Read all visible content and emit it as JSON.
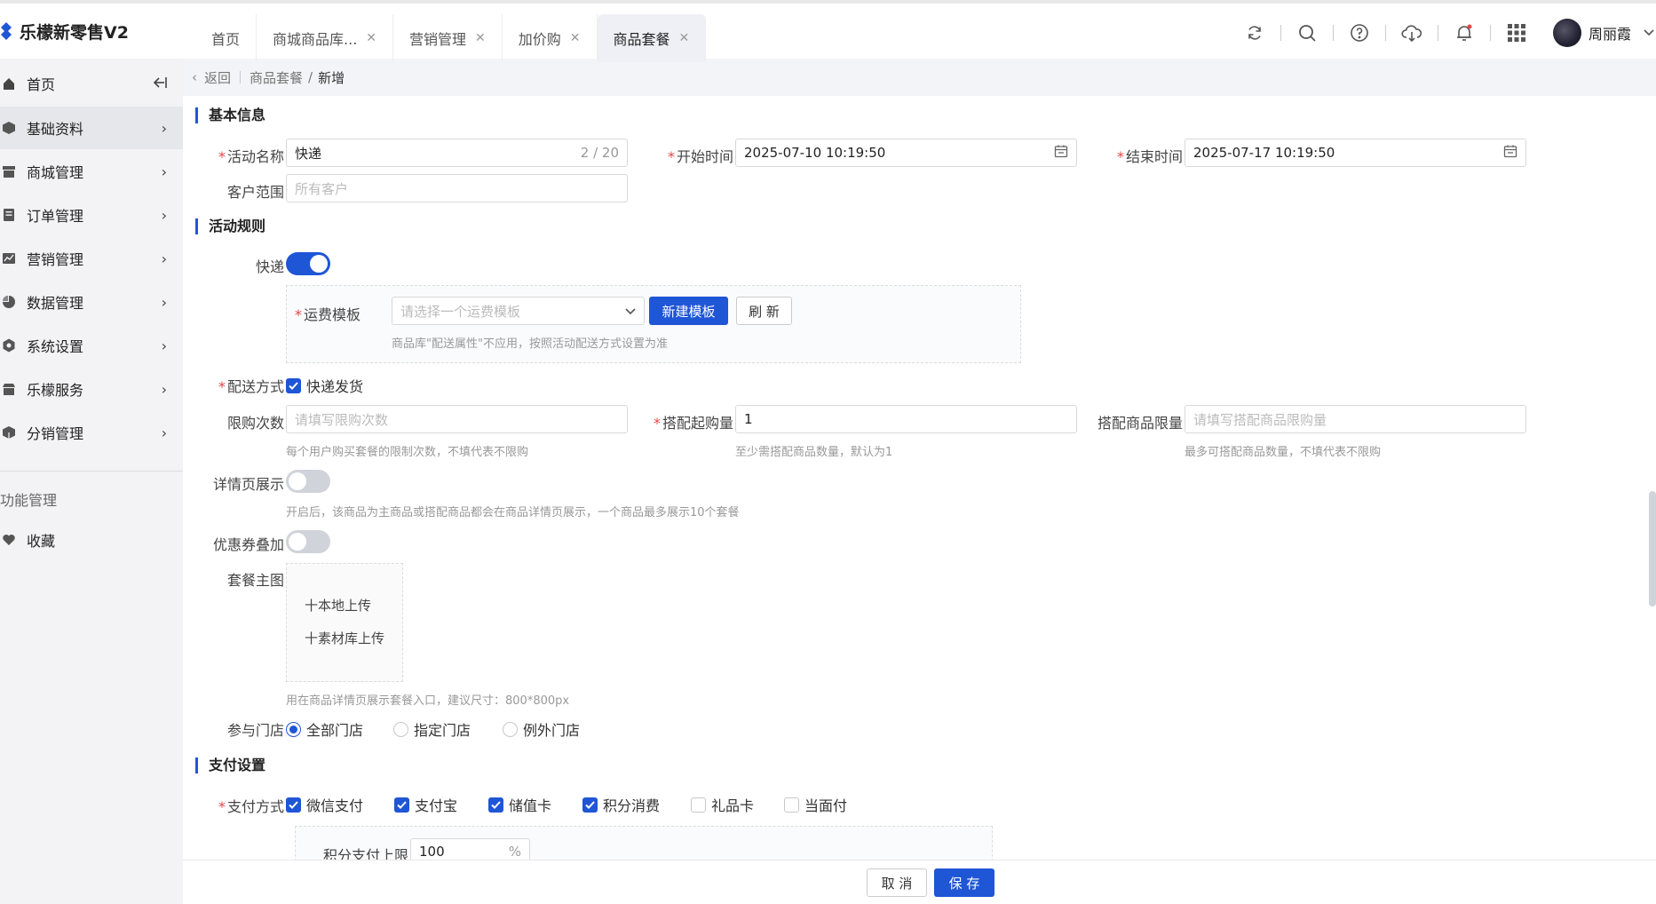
{
  "app": {
    "title": "乐檬新零售V2"
  },
  "tabs": [
    {
      "label": "首页",
      "closable": false,
      "active": false
    },
    {
      "label": "商城商品库...",
      "closable": true,
      "active": false
    },
    {
      "label": "营销管理",
      "closable": true,
      "active": false
    },
    {
      "label": "加价购",
      "closable": true,
      "active": false
    },
    {
      "label": "商品套餐",
      "closable": true,
      "active": true
    }
  ],
  "user": {
    "name": "周丽霞"
  },
  "sidebar": {
    "items": [
      {
        "label": "首页",
        "icon": "home-icon"
      },
      {
        "label": "基础资料",
        "icon": "cube-icon"
      },
      {
        "label": "商城管理",
        "icon": "store-icon"
      },
      {
        "label": "订单管理",
        "icon": "order-icon"
      },
      {
        "label": "营销管理",
        "icon": "chart-icon"
      },
      {
        "label": "数据管理",
        "icon": "pie-icon"
      },
      {
        "label": "系统设置",
        "icon": "gear-icon"
      },
      {
        "label": "乐檬服务",
        "icon": "service-icon"
      },
      {
        "label": "分销管理",
        "icon": "distribution-icon"
      }
    ],
    "group_label": "功能管理",
    "favorites_label": "收藏"
  },
  "breadcrumb": {
    "back": "返回",
    "parent": "商品套餐",
    "separator": "/",
    "current": "新增"
  },
  "sections": {
    "basic": "基本信息",
    "rules": "活动规则",
    "payment": "支付设置"
  },
  "basic": {
    "name_label": "活动名称",
    "name_value": "快递",
    "name_count": "2 / 20",
    "start_label": "开始时间",
    "start_value": "2025-07-10 10:19:50",
    "end_label": "结束时间",
    "end_value": "2025-07-17 10:19:50",
    "customer_label": "客户范围",
    "customer_placeholder": "所有客户"
  },
  "rules": {
    "express_label": "快递",
    "express_on": true,
    "freight_label": "运费模板",
    "freight_placeholder": "请选择一个运费模板",
    "new_template_btn": "新建模板",
    "refresh_btn": "刷 新",
    "freight_hint": "商品库\"配送属性\"不应用，按照活动配送方式设置为准",
    "delivery_label": "配送方式",
    "delivery_option": "快递发货",
    "delivery_checked": true,
    "limit_label": "限购次数",
    "limit_placeholder": "请填写限购次数",
    "limit_hint": "每个用户购买套餐的限制次数，不填代表不限购",
    "min_label": "搭配起购量",
    "min_value": "1",
    "min_hint": "至少需搭配商品数量，默认为1",
    "max_label": "搭配商品限量",
    "max_placeholder": "请填写搭配商品限购量",
    "max_hint": "最多可搭配商品数量，不填代表不限购",
    "detail_label": "详情页展示",
    "detail_on": false,
    "detail_hint": "开启后，该商品为主商品或搭配商品都会在商品详情页展示，一个商品最多展示10个套餐",
    "coupon_label": "优惠券叠加",
    "coupon_on": false,
    "image_label": "套餐主图",
    "upload_local": "十本地上传",
    "upload_library": "十素材库上传",
    "image_hint": "用在商品详情页展示套餐入口，建议尺寸：800*800px",
    "store_label": "参与门店",
    "store_options": [
      "全部门店",
      "指定门店",
      "例外门店"
    ],
    "store_selected": 0
  },
  "payment": {
    "method_label": "支付方式",
    "methods": [
      {
        "label": "微信支付",
        "checked": true
      },
      {
        "label": "支付宝",
        "checked": true
      },
      {
        "label": "储值卡",
        "checked": true
      },
      {
        "label": "积分消费",
        "checked": true
      },
      {
        "label": "礼品卡",
        "checked": false
      },
      {
        "label": "当面付",
        "checked": false
      }
    ],
    "points_limit_label": "积分支付上限",
    "points_limit_value": "100",
    "points_limit_unit": "%"
  },
  "footer": {
    "cancel": "取 消",
    "save": "保 存"
  },
  "colors": {
    "accent": "#1f56d6",
    "required": "#e54545"
  }
}
